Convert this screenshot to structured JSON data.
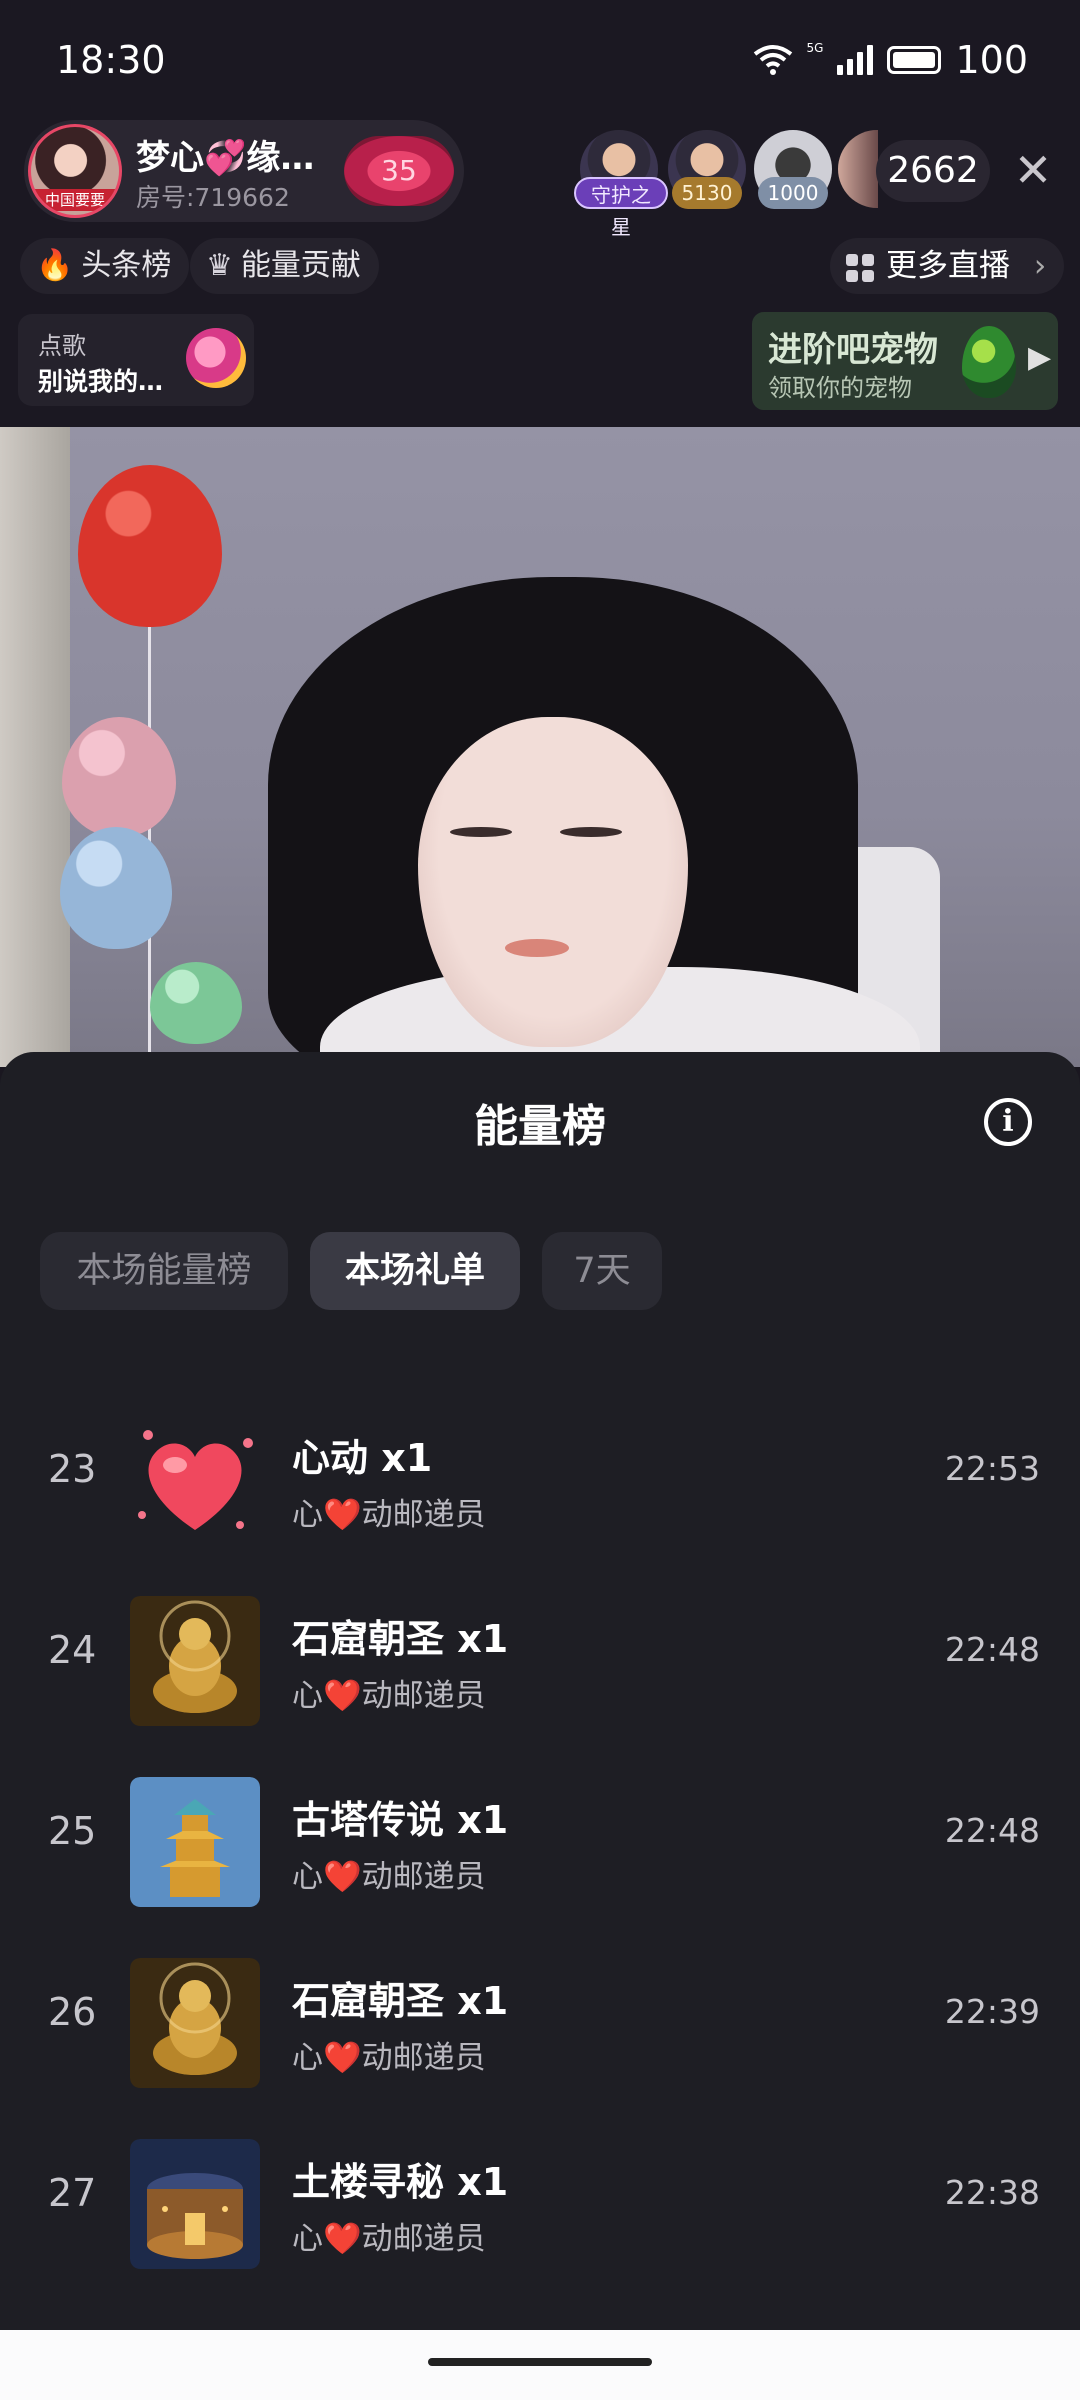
{
  "status_bar": {
    "time": "18:30",
    "network": "5G",
    "battery": "100"
  },
  "room": {
    "anchor_name": "梦心💞缘…",
    "room_id": "房号:719662",
    "anchor_tag": "中国要要",
    "level": "35",
    "viewers": [
      {
        "tag": "守护之星"
      },
      {
        "tag": "5130"
      },
      {
        "tag": "1000"
      }
    ],
    "viewer_count": "2662",
    "close_glyph": "✕"
  },
  "chips": {
    "headline": "头条榜",
    "energy_contrib": "能量贡献",
    "more_live": "更多直播",
    "more_arrow": "›"
  },
  "song_card": {
    "label": "点歌",
    "title": "别说我的…"
  },
  "pet_card": {
    "title": "进阶吧宠物",
    "subtitle": "领取你的宠物",
    "arrow": "▶"
  },
  "sheet": {
    "title": "能量榜",
    "info_glyph": "i",
    "tabs": [
      "本场能量榜",
      "本场礼单",
      "7天"
    ],
    "active_tab": "本场礼单"
  },
  "gift_list": [
    {
      "rank": "23",
      "gift": "心动  x1",
      "giver": "心❤️动邮递员",
      "time": "22:53",
      "icon": "heart-gift-icon"
    },
    {
      "rank": "24",
      "gift": "石窟朝圣  x1",
      "giver": "心❤️动邮递员",
      "time": "22:48",
      "icon": "buddha-gift-icon"
    },
    {
      "rank": "25",
      "gift": "古塔传说  x1",
      "giver": "心❤️动邮递员",
      "time": "22:48",
      "icon": "pagoda-gift-icon"
    },
    {
      "rank": "26",
      "gift": "石窟朝圣  x1",
      "giver": "心❤️动邮递员",
      "time": "22:39",
      "icon": "buddha-gift-icon"
    },
    {
      "rank": "27",
      "gift": "土楼寻秘  x1",
      "giver": "心❤️动邮递员",
      "time": "22:38",
      "icon": "tulou-gift-icon"
    }
  ]
}
